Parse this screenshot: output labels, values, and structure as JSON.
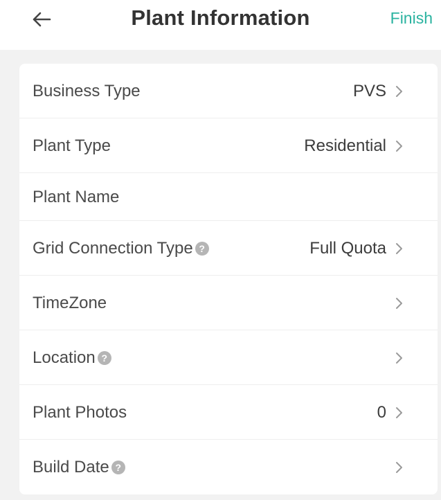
{
  "header": {
    "title": "Plant Information",
    "finish_label": "Finish",
    "accent_color": "#2bb3a0"
  },
  "rows": [
    {
      "label": "Business Type",
      "value": "PVS",
      "has_help": false,
      "has_chevron": true
    },
    {
      "label": "Plant Type",
      "value": "Residential",
      "has_help": false,
      "has_chevron": true
    },
    {
      "label": "Plant Name",
      "value": "",
      "has_help": false,
      "has_chevron": false
    },
    {
      "label": "Grid Connection Type",
      "value": "Full Quota",
      "has_help": true,
      "has_chevron": true
    },
    {
      "label": "TimeZone",
      "value": "",
      "has_help": false,
      "has_chevron": true
    },
    {
      "label": "Location",
      "value": "",
      "has_help": true,
      "has_chevron": true
    },
    {
      "label": "Plant Photos",
      "value": "0",
      "has_help": false,
      "has_chevron": true
    },
    {
      "label": "Build Date",
      "value": "",
      "has_help": true,
      "has_chevron": true
    }
  ],
  "icons": {
    "back": "arrow-left-icon",
    "help": "question-circle-icon",
    "chevron": "chevron-right-icon"
  }
}
